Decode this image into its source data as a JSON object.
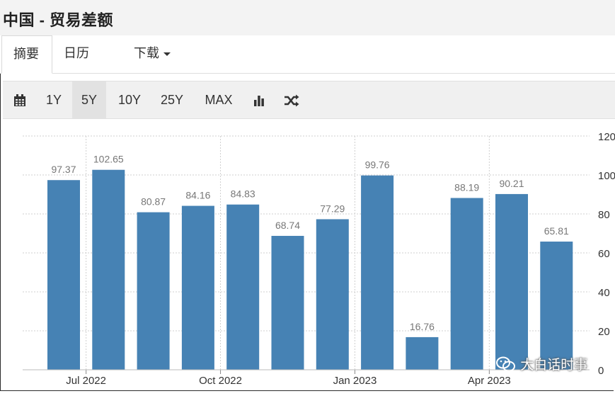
{
  "title": "中国 - 贸易差额",
  "tabs": [
    {
      "label": "摘要"
    },
    {
      "label": "日历"
    },
    {
      "label": "下载"
    }
  ],
  "toolbar": {
    "ranges": [
      "1Y",
      "5Y",
      "10Y",
      "25Y",
      "MAX"
    ],
    "active_range": "5Y",
    "icons": [
      "calendar-icon",
      "bar-chart-icon",
      "shuffle-icon"
    ]
  },
  "watermark": "大白话时事",
  "colors": {
    "bar": "#4682b4",
    "grid": "#cfcfcf",
    "label": "#777777"
  },
  "chart_data": {
    "type": "bar",
    "categories": [
      "",
      "Jul 2022",
      "",
      "",
      "Oct 2022",
      "",
      "",
      "Jan 2023",
      "",
      "",
      "Apr 2023",
      ""
    ],
    "values": [
      97.37,
      102.65,
      80.87,
      84.16,
      84.83,
      68.74,
      77.29,
      99.76,
      16.76,
      88.19,
      90.21,
      65.81
    ],
    "data_labels": [
      "97.37",
      "102.65",
      "80.87",
      "84.16",
      "84.83",
      "68.74",
      "77.29",
      "99.76",
      "16.76",
      "88.19",
      "90.21",
      "65.81"
    ],
    "yticks": [
      "0",
      "20",
      "40",
      "60",
      "80",
      "100",
      "120"
    ],
    "ylim": [
      0,
      120
    ],
    "y_axis_side": "right",
    "grid": true
  }
}
